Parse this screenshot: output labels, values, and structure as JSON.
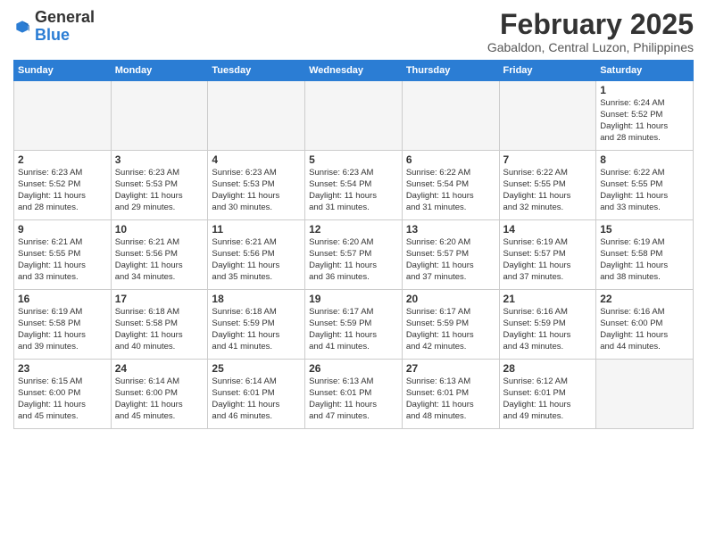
{
  "logo": {
    "general": "General",
    "blue": "Blue"
  },
  "title": "February 2025",
  "location": "Gabaldon, Central Luzon, Philippines",
  "headers": [
    "Sunday",
    "Monday",
    "Tuesday",
    "Wednesday",
    "Thursday",
    "Friday",
    "Saturday"
  ],
  "weeks": [
    [
      {
        "day": "",
        "info": ""
      },
      {
        "day": "",
        "info": ""
      },
      {
        "day": "",
        "info": ""
      },
      {
        "day": "",
        "info": ""
      },
      {
        "day": "",
        "info": ""
      },
      {
        "day": "",
        "info": ""
      },
      {
        "day": "1",
        "info": "Sunrise: 6:24 AM\nSunset: 5:52 PM\nDaylight: 11 hours\nand 28 minutes."
      }
    ],
    [
      {
        "day": "2",
        "info": "Sunrise: 6:23 AM\nSunset: 5:52 PM\nDaylight: 11 hours\nand 28 minutes."
      },
      {
        "day": "3",
        "info": "Sunrise: 6:23 AM\nSunset: 5:53 PM\nDaylight: 11 hours\nand 29 minutes."
      },
      {
        "day": "4",
        "info": "Sunrise: 6:23 AM\nSunset: 5:53 PM\nDaylight: 11 hours\nand 30 minutes."
      },
      {
        "day": "5",
        "info": "Sunrise: 6:23 AM\nSunset: 5:54 PM\nDaylight: 11 hours\nand 31 minutes."
      },
      {
        "day": "6",
        "info": "Sunrise: 6:22 AM\nSunset: 5:54 PM\nDaylight: 11 hours\nand 31 minutes."
      },
      {
        "day": "7",
        "info": "Sunrise: 6:22 AM\nSunset: 5:55 PM\nDaylight: 11 hours\nand 32 minutes."
      },
      {
        "day": "8",
        "info": "Sunrise: 6:22 AM\nSunset: 5:55 PM\nDaylight: 11 hours\nand 33 minutes."
      }
    ],
    [
      {
        "day": "9",
        "info": "Sunrise: 6:21 AM\nSunset: 5:55 PM\nDaylight: 11 hours\nand 33 minutes."
      },
      {
        "day": "10",
        "info": "Sunrise: 6:21 AM\nSunset: 5:56 PM\nDaylight: 11 hours\nand 34 minutes."
      },
      {
        "day": "11",
        "info": "Sunrise: 6:21 AM\nSunset: 5:56 PM\nDaylight: 11 hours\nand 35 minutes."
      },
      {
        "day": "12",
        "info": "Sunrise: 6:20 AM\nSunset: 5:57 PM\nDaylight: 11 hours\nand 36 minutes."
      },
      {
        "day": "13",
        "info": "Sunrise: 6:20 AM\nSunset: 5:57 PM\nDaylight: 11 hours\nand 37 minutes."
      },
      {
        "day": "14",
        "info": "Sunrise: 6:19 AM\nSunset: 5:57 PM\nDaylight: 11 hours\nand 37 minutes."
      },
      {
        "day": "15",
        "info": "Sunrise: 6:19 AM\nSunset: 5:58 PM\nDaylight: 11 hours\nand 38 minutes."
      }
    ],
    [
      {
        "day": "16",
        "info": "Sunrise: 6:19 AM\nSunset: 5:58 PM\nDaylight: 11 hours\nand 39 minutes."
      },
      {
        "day": "17",
        "info": "Sunrise: 6:18 AM\nSunset: 5:58 PM\nDaylight: 11 hours\nand 40 minutes."
      },
      {
        "day": "18",
        "info": "Sunrise: 6:18 AM\nSunset: 5:59 PM\nDaylight: 11 hours\nand 41 minutes."
      },
      {
        "day": "19",
        "info": "Sunrise: 6:17 AM\nSunset: 5:59 PM\nDaylight: 11 hours\nand 41 minutes."
      },
      {
        "day": "20",
        "info": "Sunrise: 6:17 AM\nSunset: 5:59 PM\nDaylight: 11 hours\nand 42 minutes."
      },
      {
        "day": "21",
        "info": "Sunrise: 6:16 AM\nSunset: 5:59 PM\nDaylight: 11 hours\nand 43 minutes."
      },
      {
        "day": "22",
        "info": "Sunrise: 6:16 AM\nSunset: 6:00 PM\nDaylight: 11 hours\nand 44 minutes."
      }
    ],
    [
      {
        "day": "23",
        "info": "Sunrise: 6:15 AM\nSunset: 6:00 PM\nDaylight: 11 hours\nand 45 minutes."
      },
      {
        "day": "24",
        "info": "Sunrise: 6:14 AM\nSunset: 6:00 PM\nDaylight: 11 hours\nand 45 minutes."
      },
      {
        "day": "25",
        "info": "Sunrise: 6:14 AM\nSunset: 6:01 PM\nDaylight: 11 hours\nand 46 minutes."
      },
      {
        "day": "26",
        "info": "Sunrise: 6:13 AM\nSunset: 6:01 PM\nDaylight: 11 hours\nand 47 minutes."
      },
      {
        "day": "27",
        "info": "Sunrise: 6:13 AM\nSunset: 6:01 PM\nDaylight: 11 hours\nand 48 minutes."
      },
      {
        "day": "28",
        "info": "Sunrise: 6:12 AM\nSunset: 6:01 PM\nDaylight: 11 hours\nand 49 minutes."
      },
      {
        "day": "",
        "info": ""
      }
    ]
  ]
}
